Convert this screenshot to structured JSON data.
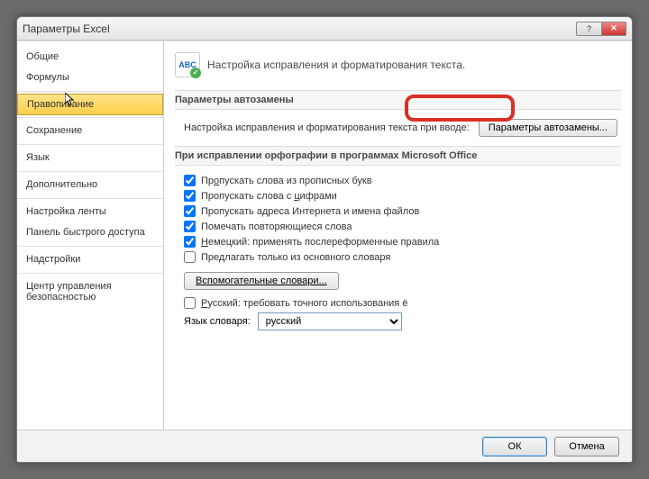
{
  "window": {
    "title": "Параметры Excel"
  },
  "sidebar": {
    "groups": [
      {
        "items": [
          "Общие",
          "Формулы"
        ]
      },
      {
        "items": [
          "Правописание"
        ]
      },
      {
        "items": [
          "Сохранение"
        ]
      },
      {
        "items": [
          "Язык"
        ]
      },
      {
        "items": [
          "Дополнительно"
        ]
      },
      {
        "items": [
          "Настройка ленты",
          "Панель быстрого доступа"
        ]
      },
      {
        "items": [
          "Надстройки"
        ]
      },
      {
        "items": [
          "Центр управления безопасностью"
        ]
      }
    ],
    "selected": "Правописание"
  },
  "content": {
    "icon_label": "ABC",
    "header_title": "Настройка исправления и форматирования текста.",
    "section1": {
      "title": "Параметры автозамены",
      "row_label": "Настройка исправления и форматирования текста при вводе:",
      "button": "Параметры автозамены..."
    },
    "section2": {
      "title": "При исправлении орфографии в программах Microsoft Office",
      "checks": [
        {
          "checked": true,
          "label": "Пропускать слова из прописных букв",
          "u": "о"
        },
        {
          "checked": true,
          "label": "Пропускать слова с цифрами",
          "u": "ц"
        },
        {
          "checked": true,
          "label": "Пропускать адреса Интернета и имена файлов"
        },
        {
          "checked": true,
          "label": "Помечать повторяющиеся слова"
        },
        {
          "checked": true,
          "label": "Немецкий: применять послереформенные правила",
          "u": "Н"
        },
        {
          "checked": false,
          "label": "Предлагать только из основного словаря"
        }
      ],
      "aux_button": "Вспомогательные словари...",
      "check_ru": {
        "checked": false,
        "label": "Русский: требовать точного использования ё",
        "u": "Р"
      },
      "lang_label": "Язык словаря:",
      "lang_selected": "русский"
    }
  },
  "footer": {
    "ok": "ОК",
    "cancel": "Отмена"
  }
}
